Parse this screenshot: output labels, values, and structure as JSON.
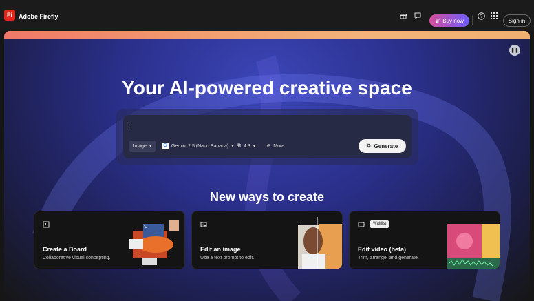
{
  "header": {
    "logo_text": "Fi",
    "brand": "Adobe Firefly",
    "buy_label": "Buy now",
    "signin_label": "Sign in"
  },
  "hero": {
    "title": "Your AI-powered creative space",
    "prompt": {
      "type_label": "Image",
      "model_label": "Gemini 2.5 (Nano Banana)",
      "ratio_label": "4:3",
      "more_label": "More",
      "generate_label": "Generate"
    }
  },
  "section": {
    "title": "New ways to create",
    "cards": [
      {
        "title": "Create a Board",
        "desc": "Collaborative visual concepting."
      },
      {
        "title": "Edit an image",
        "desc": "Use a text prompt to edit."
      },
      {
        "title": "Edit video (beta)",
        "desc": "Trim, arrange, and generate.",
        "badge": "Waitlist"
      }
    ]
  },
  "colors": {
    "logo": "#e1251b",
    "buy_start": "#d44e9a",
    "buy_end": "#6d5dfc"
  }
}
